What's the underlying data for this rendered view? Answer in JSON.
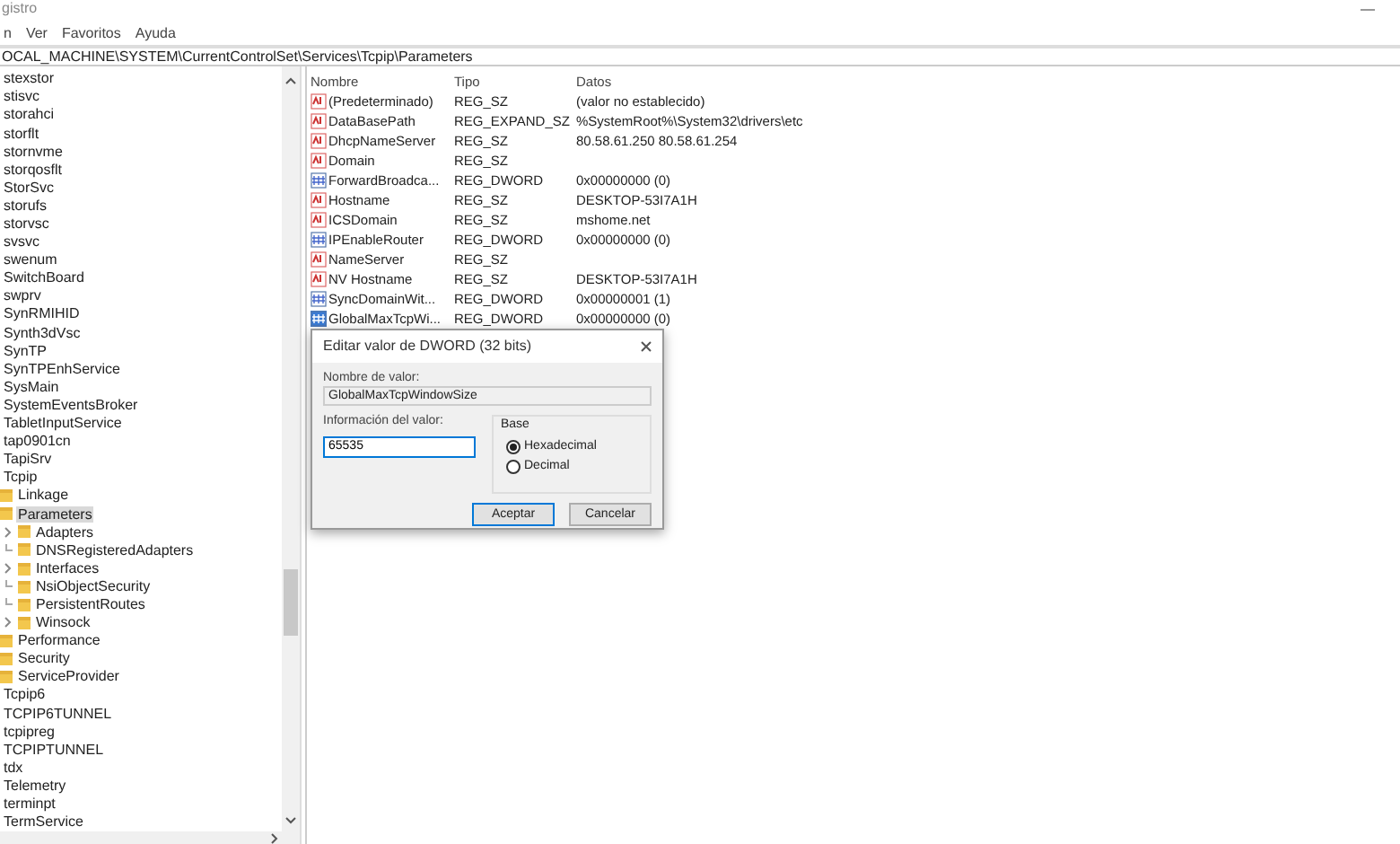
{
  "window": {
    "title": "gistro"
  },
  "menu": [
    "n",
    "Ver",
    "Favoritos",
    "Ayuda"
  ],
  "address": "OCAL_MACHINE\\SYSTEM\\CurrentControlSet\\Services\\Tcpip\\Parameters",
  "tree": [
    {
      "label": "stexstor"
    },
    {
      "label": "stisvc"
    },
    {
      "label": "storahci"
    },
    {
      "label": "storflt"
    },
    {
      "label": "stornvme"
    },
    {
      "label": "storqosflt"
    },
    {
      "label": "StorSvc"
    },
    {
      "label": "storufs"
    },
    {
      "label": "storvsc"
    },
    {
      "label": "svsvc"
    },
    {
      "label": "swenum"
    },
    {
      "label": "SwitchBoard"
    },
    {
      "label": "swprv"
    },
    {
      "label": "SynRMIHID"
    },
    {
      "label": "Synth3dVsc"
    },
    {
      "label": "SynTP"
    },
    {
      "label": "SynTPEnhService"
    },
    {
      "label": "SysMain"
    },
    {
      "label": "SystemEventsBroker"
    },
    {
      "label": "TabletInputService"
    },
    {
      "label": "tap0901cn"
    },
    {
      "label": "TapiSrv"
    },
    {
      "label": "Tcpip",
      "children": [
        {
          "label": "Linkage",
          "selected": false
        },
        {
          "label": "Parameters",
          "selected": true,
          "children": [
            {
              "label": "Adapters",
              "expandable": true
            },
            {
              "label": "DNSRegisteredAdapters",
              "expandable": false
            },
            {
              "label": "Interfaces",
              "expandable": true
            },
            {
              "label": "NsiObjectSecurity",
              "expandable": false
            },
            {
              "label": "PersistentRoutes",
              "expandable": false
            },
            {
              "label": "Winsock",
              "expandable": true
            }
          ]
        },
        {
          "label": "Performance",
          "selected": false
        },
        {
          "label": "Security",
          "selected": false
        },
        {
          "label": "ServiceProvider",
          "selected": false
        }
      ]
    },
    {
      "label": "Tcpip6"
    },
    {
      "label": "TCPIP6TUNNEL"
    },
    {
      "label": "tcpipreg"
    },
    {
      "label": "TCPIPTUNNEL"
    },
    {
      "label": "tdx"
    },
    {
      "label": "Telemetry"
    },
    {
      "label": "terminpt"
    },
    {
      "label": "TermService"
    }
  ],
  "values": {
    "columns": [
      "Nombre",
      "Tipo",
      "Datos"
    ],
    "rows": [
      {
        "name": "(Predeterminado)",
        "type": "REG_SZ",
        "data": "(valor no establecido)",
        "kind": "string",
        "selected": false
      },
      {
        "name": "DataBasePath",
        "type": "REG_EXPAND_SZ",
        "data": "%SystemRoot%\\System32\\drivers\\etc",
        "kind": "string",
        "selected": false
      },
      {
        "name": "DhcpNameServer",
        "type": "REG_SZ",
        "data": "80.58.61.250 80.58.61.254",
        "kind": "string",
        "selected": false
      },
      {
        "name": "Domain",
        "type": "REG_SZ",
        "kind": "string",
        "selected": false
      },
      {
        "name": "ForwardBroadca...",
        "type": "REG_DWORD",
        "data": "0x00000000 (0)",
        "kind": "binary",
        "selected": false
      },
      {
        "name": "Hostname",
        "type": "REG_SZ",
        "data": "DESKTOP-53I7A1H",
        "kind": "string",
        "selected": false
      },
      {
        "name": "ICSDomain",
        "type": "REG_SZ",
        "data": "mshome.net",
        "kind": "string",
        "selected": false
      },
      {
        "name": "IPEnableRouter",
        "type": "REG_DWORD",
        "data": "0x00000000 (0)",
        "kind": "binary",
        "selected": false
      },
      {
        "name": "NameServer",
        "type": "REG_SZ",
        "kind": "string",
        "selected": false
      },
      {
        "name": "NV Hostname",
        "type": "REG_SZ",
        "data": "DESKTOP-53I7A1H",
        "kind": "string",
        "selected": false
      },
      {
        "name": "SyncDomainWit...",
        "type": "REG_DWORD",
        "data": "0x00000001 (1)",
        "kind": "binary",
        "selected": false
      },
      {
        "name": "GlobalMaxTcpWi...",
        "type": "REG_DWORD",
        "data": "0x00000000 (0)",
        "kind": "binary",
        "selected": true
      }
    ]
  },
  "dialog": {
    "title": "Editar valor de DWORD (32 bits)",
    "name_label": "Nombre de valor:",
    "name_value": "GlobalMaxTcpWindowSize",
    "data_label": "Información del valor:",
    "data_value": "65535",
    "base_label": "Base",
    "options": [
      {
        "label": "Hexadecimal",
        "selected": true
      },
      {
        "label": "Decimal",
        "selected": false
      }
    ],
    "buttons": [
      {
        "label": "Aceptar",
        "default": true
      },
      {
        "label": "Cancelar",
        "default": false
      }
    ]
  }
}
